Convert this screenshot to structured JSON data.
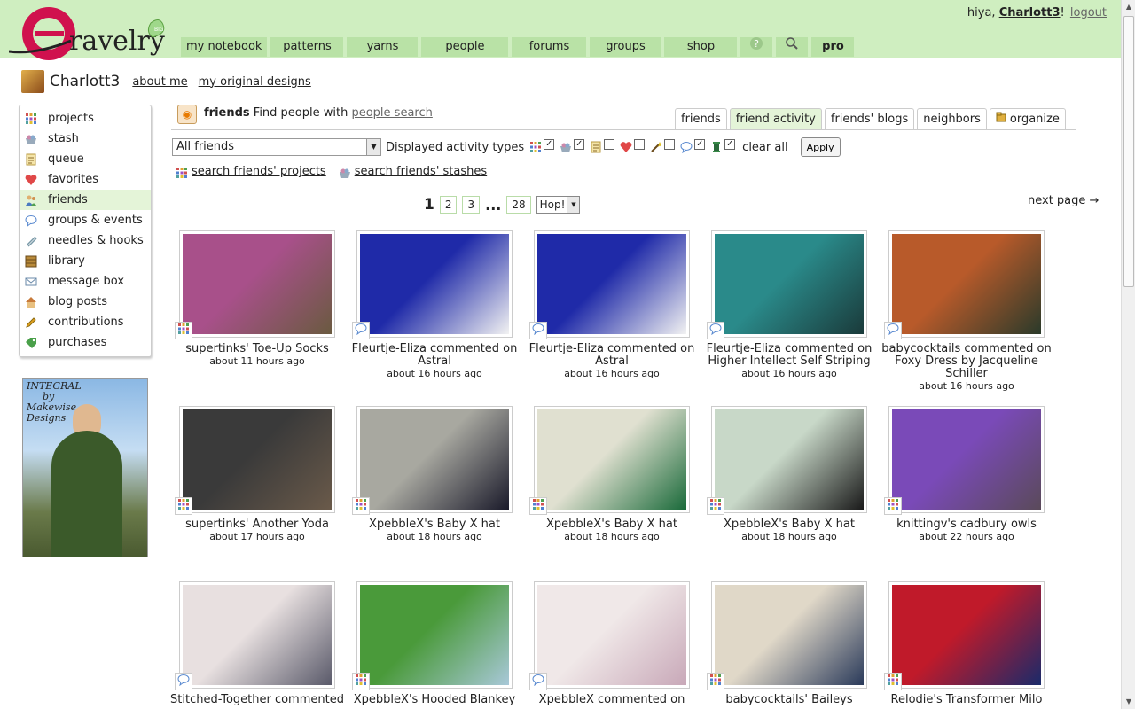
{
  "header": {
    "brand": "ravelry",
    "logo_badge": "BIG",
    "greeting_prefix": "hiya, ",
    "username": "Charlott3",
    "greeting_suffix": "!",
    "logout": "logout"
  },
  "nav": [
    "my notebook",
    "patterns",
    "yarns",
    "people",
    "forums",
    "groups",
    "shop"
  ],
  "nav_icons": [
    "help-icon",
    "search-icon"
  ],
  "nav_pro": "pro",
  "user": {
    "name": "Charlott3",
    "about": "about me",
    "designs": "my original designs"
  },
  "sidebar": [
    {
      "label": "projects",
      "icon": "projects-icon",
      "color": "#d05050",
      "active": false
    },
    {
      "label": "stash",
      "icon": "stash-icon",
      "color": "#7a8aa0",
      "active": false
    },
    {
      "label": "queue",
      "icon": "queue-icon",
      "color": "#c8a040",
      "active": false
    },
    {
      "label": "favorites",
      "icon": "heart-icon",
      "color": "#e04848",
      "active": false
    },
    {
      "label": "friends",
      "icon": "friends-icon",
      "color": "#4a7ac0",
      "active": true
    },
    {
      "label": "groups & events",
      "icon": "speech-bubble-icon",
      "color": "#5a8ad0",
      "active": false
    },
    {
      "label": "needles & hooks",
      "icon": "needles-icon",
      "color": "#7a9aa8",
      "active": false
    },
    {
      "label": "library",
      "icon": "library-icon",
      "color": "#8a6a2a",
      "active": false
    },
    {
      "label": "message box",
      "icon": "envelope-icon",
      "color": "#6a8aaa",
      "active": false
    },
    {
      "label": "blog posts",
      "icon": "house-icon",
      "color": "#c87a3a",
      "active": false
    },
    {
      "label": "contributions",
      "icon": "pencil-icon",
      "color": "#e0a020",
      "active": false
    },
    {
      "label": "purchases",
      "icon": "tag-icon",
      "color": "#4aa04a",
      "active": false
    }
  ],
  "ad": {
    "line1": "INTEGRAL",
    "line2": "by",
    "line3": "Makewise",
    "line4": "Designs"
  },
  "friends": {
    "title": "friends",
    "text": "Find people with",
    "link": "people search",
    "tabs": [
      "friends",
      "friend activity",
      "friends' blogs",
      "neighbors",
      "organize"
    ],
    "active_tab": "friend activity"
  },
  "filter": {
    "select_value": "All friends",
    "label": "Displayed activity types",
    "types": [
      {
        "icon": "projects-icon",
        "checked": true
      },
      {
        "icon": "stash-icon",
        "checked": true
      },
      {
        "icon": "queue-icon",
        "checked": false
      },
      {
        "icon": "heart-icon",
        "checked": false
      },
      {
        "icon": "wand-icon",
        "checked": false
      },
      {
        "icon": "speech-bubble-icon",
        "checked": true
      },
      {
        "icon": "spool-icon",
        "checked": true
      }
    ],
    "clear_all": "clear all",
    "apply": "Apply"
  },
  "search_links": [
    "search friends' projects",
    "search friends' stashes"
  ],
  "pager": {
    "current": "1",
    "pages": [
      "2",
      "3"
    ],
    "dots": "...",
    "last": "28",
    "hop": "Hop!",
    "next": "next page →"
  },
  "activity": [
    {
      "caption": "supertinks' Toe-Up Socks",
      "when": "about 11 hours ago",
      "badge": "projects-icon",
      "color": "#a8508a",
      "color2": "#6a5a40"
    },
    {
      "caption": "Fleurtje-Eliza commented on Astral",
      "when": "about 16 hours ago",
      "badge": "speech-bubble-icon",
      "color": "#1f2aa8",
      "color2": "#f2f2f2"
    },
    {
      "caption": "Fleurtje-Eliza commented on Astral",
      "when": "about 16 hours ago",
      "badge": "speech-bubble-icon",
      "color": "#1f2aa8",
      "color2": "#f2f2f2"
    },
    {
      "caption": "Fleurtje-Eliza commented on Higher Intellect Self Striping",
      "when": "about 16 hours ago",
      "badge": "speech-bubble-icon",
      "color": "#2a8a8a",
      "color2": "#1a3a3a"
    },
    {
      "caption": "babycocktails commented on Foxy Dress by Jacqueline Schiller",
      "when": "about 16 hours ago",
      "badge": "speech-bubble-icon",
      "color": "#b85a2a",
      "color2": "#2a3a2a"
    },
    {
      "caption": "supertinks' Another Yoda",
      "when": "about 17 hours ago",
      "badge": "projects-icon",
      "color": "#3a3a3a",
      "color2": "#6a5a4a"
    },
    {
      "caption": "XpebbleX's Baby X hat",
      "when": "about 18 hours ago",
      "badge": "projects-icon",
      "color": "#a8a8a0",
      "color2": "#1a1a2a"
    },
    {
      "caption": "XpebbleX's Baby X hat",
      "when": "about 18 hours ago",
      "badge": "projects-icon",
      "color": "#e0e0d0",
      "color2": "#1a6a3a"
    },
    {
      "caption": "XpebbleX's Baby X hat",
      "when": "about 18 hours ago",
      "badge": "projects-icon",
      "color": "#c8d8c8",
      "color2": "#1a1a1a"
    },
    {
      "caption": "knittingv's cadbury owls",
      "when": "about 22 hours ago",
      "badge": "projects-icon",
      "color": "#7a4ab8",
      "color2": "#5a4a5a"
    },
    {
      "caption": "Stitched-Together commented",
      "when": "",
      "badge": "speech-bubble-icon",
      "color": "#e8e0e0",
      "color2": "#5a5a6a"
    },
    {
      "caption": "XpebbleX's Hooded Blankey",
      "when": "",
      "badge": "projects-icon",
      "color": "#4a9a3a",
      "color2": "#a8c8d8"
    },
    {
      "caption": "XpebbleX commented on",
      "when": "",
      "badge": "speech-bubble-icon",
      "color": "#f0e8e8",
      "color2": "#c8a8b8"
    },
    {
      "caption": "babycocktails' Baileys",
      "when": "",
      "badge": "projects-icon",
      "color": "#e0d8c8",
      "color2": "#2a3a5a"
    },
    {
      "caption": "Relodie's Transformer Milo",
      "when": "",
      "badge": "projects-icon",
      "color": "#c01a2a",
      "color2": "#1a2a6a"
    }
  ]
}
